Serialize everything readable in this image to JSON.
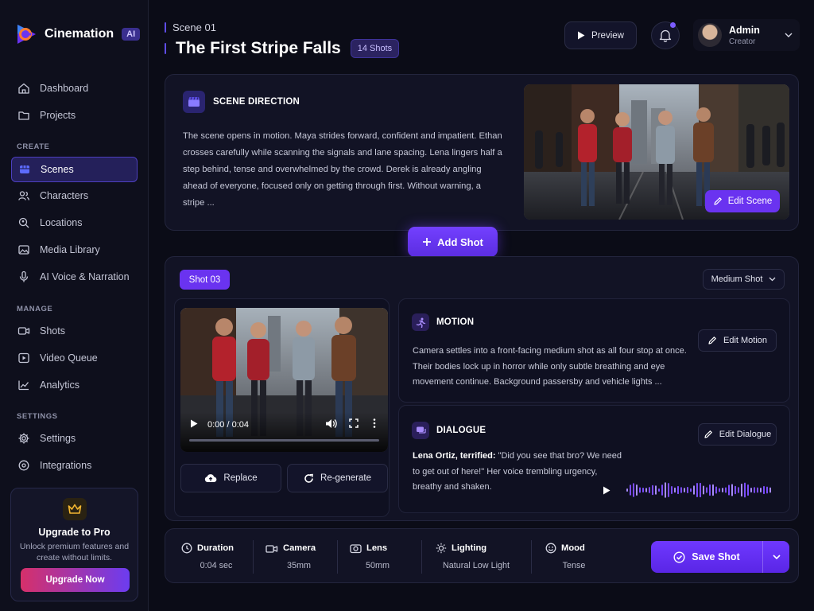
{
  "app": {
    "name": "Cinemation",
    "badge": "AI"
  },
  "sidebar": {
    "top_items": [
      {
        "label": "Dashboard",
        "icon": "home-icon"
      },
      {
        "label": "Projects",
        "icon": "folder-icon"
      }
    ],
    "create_section": "CREATE",
    "create_items": [
      {
        "label": "Scenes",
        "icon": "scenes-icon",
        "active": true
      },
      {
        "label": "Characters",
        "icon": "users-icon"
      },
      {
        "label": "Locations",
        "icon": "location-icon"
      },
      {
        "label": "Media Library",
        "icon": "image-icon"
      },
      {
        "label": "AI Voice & Narration",
        "icon": "mic-icon"
      }
    ],
    "manage_section": "MANAGE",
    "manage_items": [
      {
        "label": "Shots",
        "icon": "camera-icon"
      },
      {
        "label": "Video Queue",
        "icon": "play-box-icon"
      },
      {
        "label": "Analytics",
        "icon": "chart-icon"
      }
    ],
    "settings_section": "SETTINGS",
    "settings_items": [
      {
        "label": "Settings",
        "icon": "gear-icon"
      },
      {
        "label": "Integrations",
        "icon": "plug-icon"
      }
    ],
    "upgrade": {
      "title": "Upgrade to Pro",
      "text": "Unlock premium features and create without limits.",
      "button": "Upgrade Now"
    }
  },
  "header": {
    "breadcrumb": "Scene 01",
    "title": "The First Stripe Falls",
    "shots_badge": "14 Shots",
    "preview": "Preview",
    "user": {
      "name": "Admin",
      "role": "Creator"
    }
  },
  "scene": {
    "section_title": "SCENE DIRECTION",
    "text": "The scene opens in motion. Maya strides forward, confident and impatient. Ethan crosses carefully while scanning the signals and lane spacing. Lena lingers half a step behind, tense and overwhelmed by the crowd. Derek is already angling ahead of everyone, focused only on getting through first. Without warning, a stripe ...",
    "edit_button": "Edit Scene"
  },
  "add_shot": "Add Shot",
  "shot": {
    "badge": "Shot 03",
    "type": "Medium Shot",
    "video": {
      "time": "0:00 / 0:04",
      "progress": 0
    },
    "replace": "Replace",
    "regenerate": "Re-generate",
    "motion": {
      "title": "MOTION",
      "text": "Camera settles into a front-facing medium shot as all four stop at once. Their bodies lock up in horror while only subtle breathing and eye movement continue. Background passersby and vehicle lights ...",
      "edit": "Edit Motion"
    },
    "dialogue": {
      "title": "DIALOGUE",
      "speaker": "Lena Ortiz, terrified:",
      "text": " \"Did you see that bro? We need to get out of here!\" Her voice trembling urgency, breathy and shaken.",
      "edit": "Edit Dialogue"
    }
  },
  "properties": [
    {
      "label": "Duration",
      "value": "0:04 sec",
      "icon": "clock-icon"
    },
    {
      "label": "Camera",
      "value": "35mm",
      "icon": "camera-icon"
    },
    {
      "label": "Lens",
      "value": "50mm",
      "icon": "lens-icon"
    },
    {
      "label": "Lighting",
      "value": "Natural Low Light",
      "icon": "sun-icon"
    },
    {
      "label": "Mood",
      "value": "Tense",
      "icon": "smile-icon"
    }
  ],
  "save": "Save Shot",
  "colors": {
    "accent": "#6a33f0",
    "background": "#0b0c17",
    "panel": "#121325"
  }
}
